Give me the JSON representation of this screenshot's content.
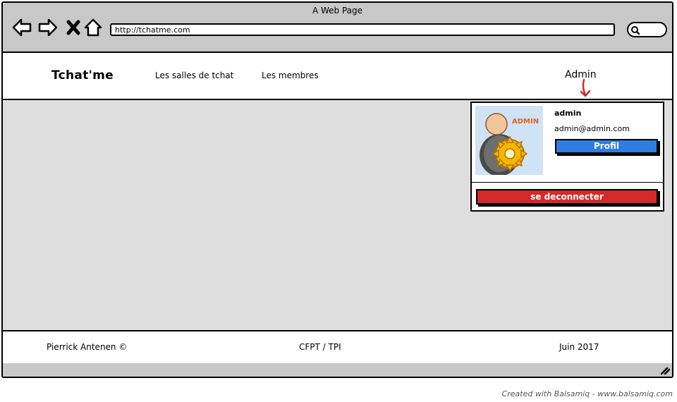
{
  "window": {
    "title": "A Web Page"
  },
  "browser": {
    "url": "http://tchatme.com"
  },
  "navbar": {
    "brand": "Tchat'me",
    "links": [
      "Les salles de tchat",
      "Les membres"
    ],
    "user_menu_label": "Admin"
  },
  "user_dropdown": {
    "avatar_label": "ADMIN",
    "username": "admin",
    "email": "admin@admin.com",
    "profile_button": "Profil",
    "logout_button": "se deconnecter"
  },
  "footer": {
    "left": "Pierrick Antenen ©",
    "center": "CFPT / TPI",
    "right": "Juin 2017"
  },
  "watermark": "Created with Balsamiq - www.balsamiq.com",
  "colors": {
    "profile_button": "#2f7de0",
    "logout_button": "#d32a2a",
    "arrow": "#d32a2a"
  },
  "icons": [
    "back-icon",
    "forward-icon",
    "close-icon",
    "home-icon",
    "search-icon",
    "resize-grip-icon",
    "admin-gear-icon"
  ]
}
